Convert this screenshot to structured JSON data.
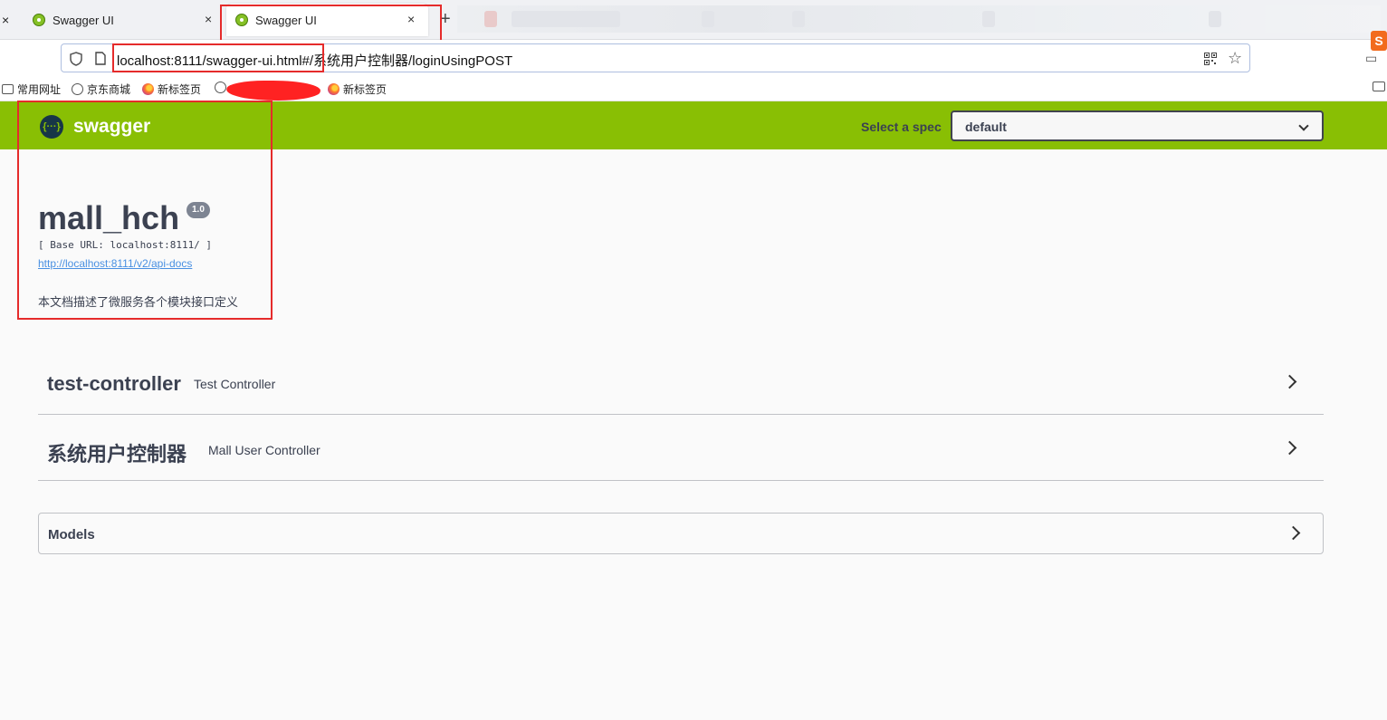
{
  "browser": {
    "tabs": [
      {
        "title": "Swagger UI",
        "active": false
      },
      {
        "title": "Swagger UI",
        "active": true
      }
    ],
    "close_glyph": "×",
    "new_tab_glyph": "+",
    "address": "localhost:8111/swagger-ui.html#/系统用户控制器/loginUsingPOST",
    "bookmarks": [
      {
        "label": "常用网址",
        "icon": "folder-icon"
      },
      {
        "label": "京东商城",
        "icon": "globe-icon"
      },
      {
        "label": "新标签页",
        "icon": "firefox-icon"
      },
      {
        "label": "新标签页",
        "icon": "firefox-icon"
      }
    ],
    "highlight_color": "#e52b2b"
  },
  "swagger": {
    "brand": "swagger",
    "logo_glyph": "{···}",
    "spec_label": "Select a spec",
    "spec_value": "default",
    "topbar_color": "#89bf04"
  },
  "info": {
    "title": "mall_hch",
    "version": "1.0",
    "base_url": "[ Base URL: localhost:8111/ ]",
    "docs_link": "http://localhost:8111/v2/api-docs",
    "description": "本文档描述了微服务各个模块接口定义"
  },
  "tags": [
    {
      "name": "test-controller",
      "description": "Test Controller"
    },
    {
      "name": "系统用户控制器",
      "description": "Mall User Controller"
    }
  ],
  "models": {
    "label": "Models"
  }
}
